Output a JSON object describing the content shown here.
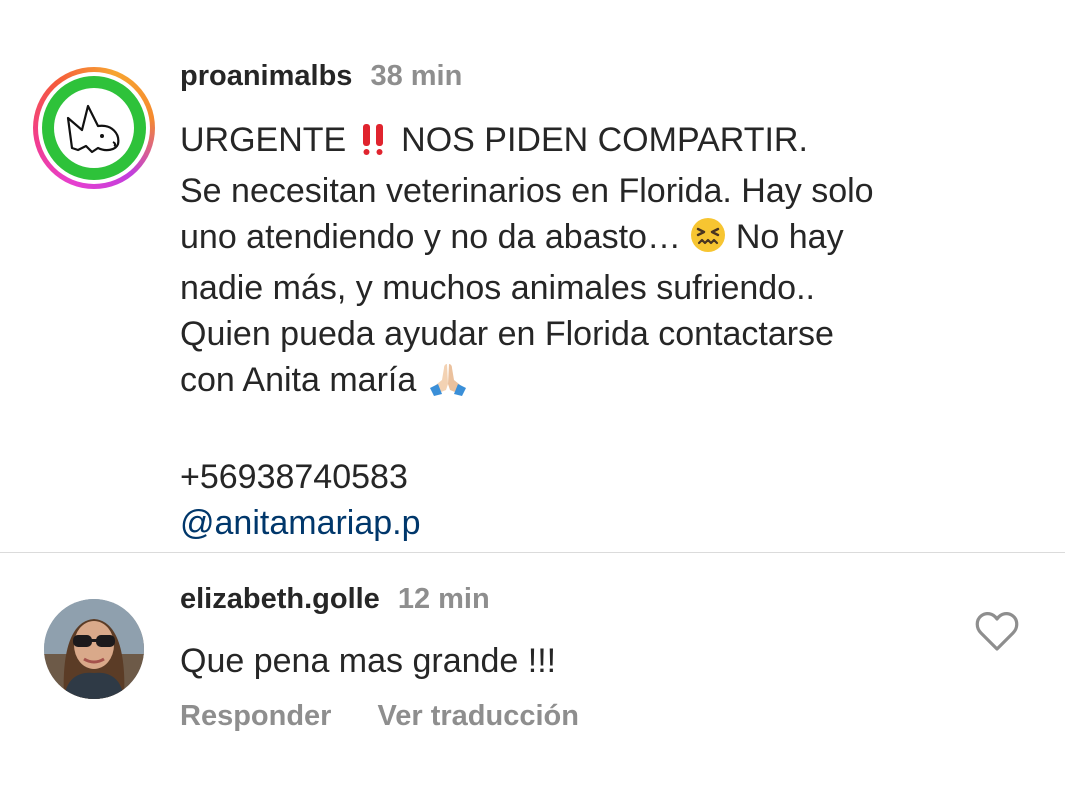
{
  "post": {
    "username": "proanimalbs",
    "time": "38 min",
    "caption_lines": [
      "URGENTE",
      "NOS PIDEN COMPARTIR.",
      "Se necesitan veterinarios en Florida. Hay solo",
      "uno atendiendo y no da abasto…",
      "No hay",
      "nadie más, y muchos animales sufriendo..",
      "Quien pueda ayudar en Florida contactarse",
      "con Anita maría",
      "+56938740583",
      "@anitamariap.p"
    ],
    "avatar_icon": "dog-logo-icon",
    "emoji_icons": [
      "double-exclamation-icon",
      "confounded-face-icon",
      "folded-hands-icon"
    ]
  },
  "comment": {
    "username": "elizabeth.golle",
    "time": "12 min",
    "text": "Que pena mas grande !!!",
    "reply_label": "Responder",
    "translate_label": "Ver traducción",
    "like_icon": "heart-outline-icon"
  },
  "colors": {
    "text": "#262626",
    "secondary": "#8e8e8e",
    "mention": "#00376b",
    "divider": "#dbdbdb",
    "logo_green": "#2ec23a",
    "story_ring": "#e63fd0"
  }
}
